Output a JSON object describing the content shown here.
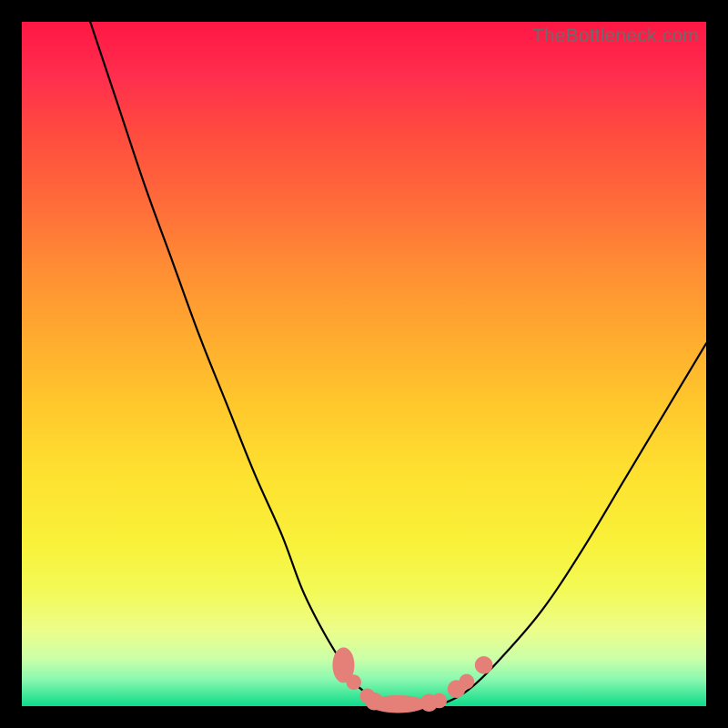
{
  "watermark": "TheBottleneck.com",
  "colors": {
    "frame_background": "#000000",
    "curve_stroke": "#000000",
    "marker_fill": "#E58079",
    "gradient_top": "#FF1744",
    "gradient_bottom": "#0DDB8B",
    "watermark_text": "#6b6b6b"
  },
  "chart_data": {
    "type": "line",
    "title": "",
    "xlabel": "",
    "ylabel": "",
    "xlim": [
      0,
      100
    ],
    "ylim": [
      0,
      100
    ],
    "grid": false,
    "legend": false,
    "annotations": [],
    "series": [
      {
        "name": "bottleneck-curve",
        "description": "V-shaped curve; estimated (x,y) in percent of plot area, y=0 at bottom",
        "x": [
          10,
          14,
          18,
          22,
          26,
          30,
          34,
          38,
          41,
          44,
          47,
          49,
          52,
          55,
          58,
          60,
          63,
          66,
          70,
          76,
          82,
          88,
          94,
          100
        ],
        "y": [
          100,
          88,
          76,
          65,
          54,
          44,
          34,
          25,
          17,
          11,
          6,
          3,
          1,
          0,
          0,
          0,
          1,
          3,
          7,
          14,
          23,
          33,
          43,
          53
        ]
      }
    ],
    "markers": {
      "description": "Salmon capsule/circle markers near the curve bottom; estimated (x,y,r) in percent of plot area, y=0 at bottom",
      "points": [
        {
          "x": 47.0,
          "y": 6.0,
          "rx": 1.6,
          "ry": 2.6
        },
        {
          "x": 48.5,
          "y": 3.5,
          "rx": 1.1,
          "ry": 1.1
        },
        {
          "x": 50.5,
          "y": 1.5,
          "rx": 1.1,
          "ry": 1.1
        },
        {
          "x": 51.5,
          "y": 0.7,
          "rx": 1.3,
          "ry": 1.3
        },
        {
          "x": 55.0,
          "y": 0.3,
          "rx": 4.2,
          "ry": 1.3
        },
        {
          "x": 59.5,
          "y": 0.5,
          "rx": 1.3,
          "ry": 1.3
        },
        {
          "x": 61.0,
          "y": 0.8,
          "rx": 1.1,
          "ry": 1.1
        },
        {
          "x": 63.5,
          "y": 2.5,
          "rx": 1.3,
          "ry": 1.3
        },
        {
          "x": 65.0,
          "y": 3.6,
          "rx": 1.1,
          "ry": 1.1
        },
        {
          "x": 67.5,
          "y": 6.0,
          "rx": 1.3,
          "ry": 1.3
        }
      ]
    }
  }
}
